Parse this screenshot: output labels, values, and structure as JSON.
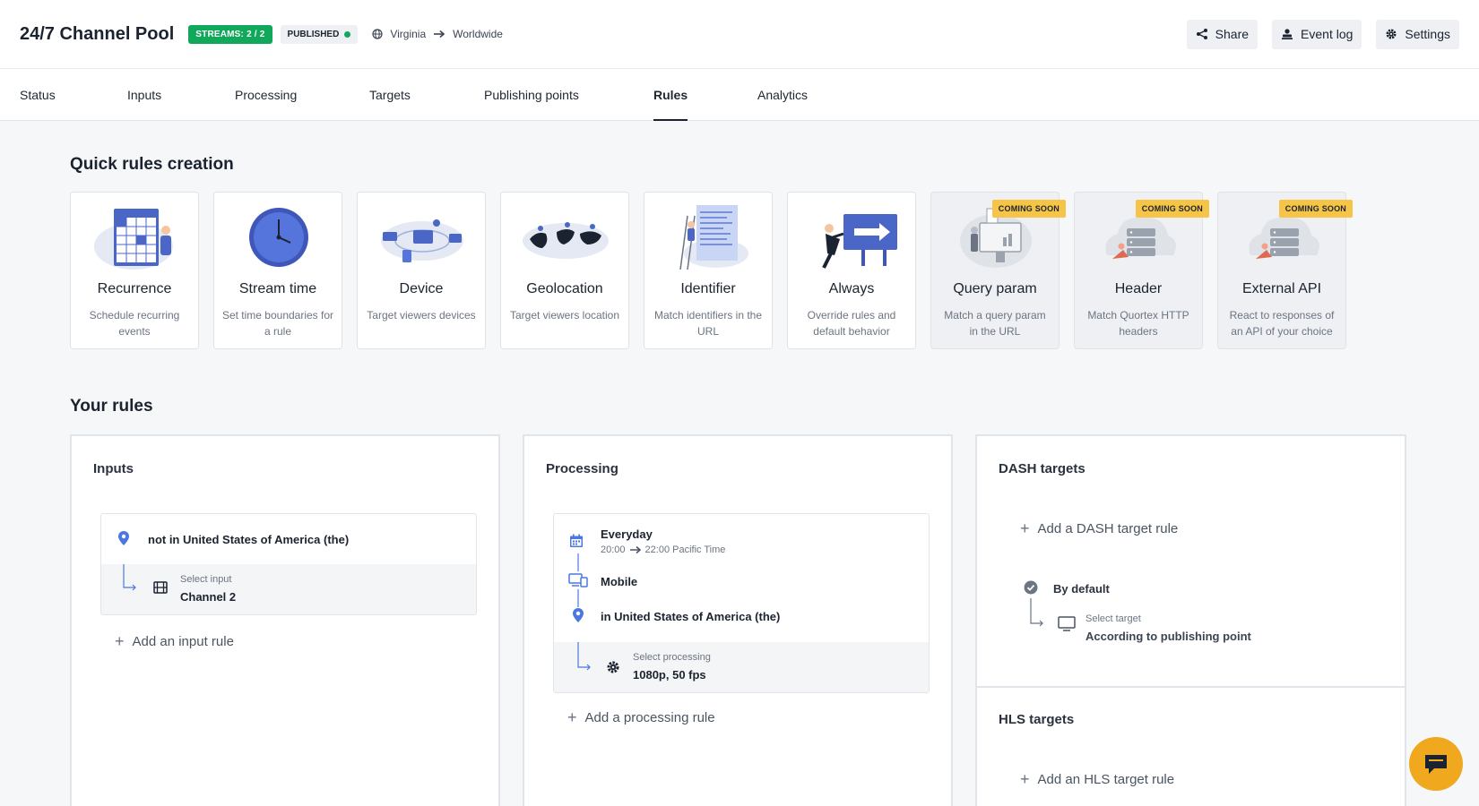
{
  "header": {
    "title": "24/7 Channel Pool",
    "streams_badge": "STREAMS: 2 / 2",
    "published_badge": "PUBLISHED",
    "route_from": "Virginia",
    "route_to": "Worldwide",
    "actions": {
      "share": "Share",
      "event_log": "Event log",
      "settings": "Settings"
    }
  },
  "tabs": [
    "Status",
    "Inputs",
    "Processing",
    "Targets",
    "Publishing points",
    "Rules",
    "Analytics"
  ],
  "active_tab": "Rules",
  "quick_rules": {
    "title": "Quick rules creation",
    "cards": [
      {
        "title": "Recurrence",
        "desc": "Schedule recurring events",
        "icon": "calendar-illustration"
      },
      {
        "title": "Stream time",
        "desc": "Set time boundaries for a rule",
        "icon": "clock-illustration"
      },
      {
        "title": "Device",
        "desc": "Target viewers devices",
        "icon": "devices-illustration"
      },
      {
        "title": "Geolocation",
        "desc": "Target viewers location",
        "icon": "world-map-illustration"
      },
      {
        "title": "Identifier",
        "desc": "Match identifiers in the URL",
        "icon": "document-illustration"
      },
      {
        "title": "Always",
        "desc": "Override rules and default behavior",
        "icon": "arrow-sign-illustration"
      },
      {
        "title": "Query param",
        "desc": "Match a query param in the URL",
        "icon": "query-illustration",
        "badge": "COMING SOON"
      },
      {
        "title": "Header",
        "desc": "Match Quortex HTTP headers",
        "icon": "server-illustration",
        "badge": "COMING SOON"
      },
      {
        "title": "External API",
        "desc": "React to responses of an API of your choice",
        "icon": "api-illustration",
        "badge": "COMING SOON"
      }
    ]
  },
  "your_rules": {
    "title": "Your rules",
    "inputs": {
      "title": "Inputs",
      "rule": {
        "condition": "not in United States of America (the)",
        "select_label": "Select input",
        "select_value": "Channel 2"
      },
      "add_label": "Add an input rule"
    },
    "processing": {
      "title": "Processing",
      "rule": {
        "schedule": "Everyday",
        "time_from": "20:00",
        "time_to": "22:00 Pacific Time",
        "device": "Mobile",
        "location": "in United States of America (the)",
        "select_label": "Select processing",
        "select_value": "1080p, 50 fps"
      },
      "add_label": "Add a processing rule"
    },
    "dash": {
      "title": "DASH targets",
      "add_label": "Add a DASH target rule",
      "default_label": "By default",
      "select_label": "Select target",
      "select_value": "According to publishing point"
    },
    "hls": {
      "title": "HLS targets",
      "add_label": "Add an HLS target rule"
    }
  },
  "colors": {
    "accent_green": "#12a85c",
    "accent_blue": "#4a78e0",
    "coming_soon": "#f6c547",
    "chat": "#f0a81e"
  }
}
